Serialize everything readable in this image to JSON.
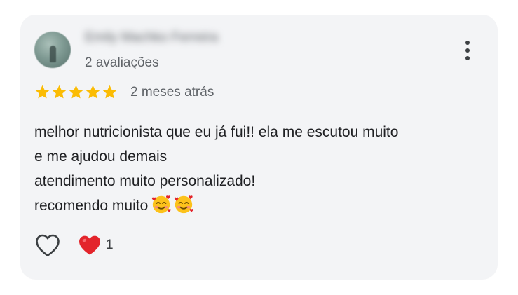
{
  "review": {
    "reviewer_name": "Emily Machko Ferreira",
    "review_count": "2 avaliações",
    "rating": 5,
    "rating_max": 5,
    "time_ago": "2 meses atrás",
    "text_lines": [
      "melhor nutricionista que eu já fui!! ela me escutou muito",
      "e me ajudou demais",
      "atendimento muito personalizado!",
      "recomendo muito"
    ],
    "emojis": [
      "🥰",
      "🥰"
    ],
    "reactions": {
      "heart_count": "1"
    }
  },
  "icons": {
    "menu": "more-vert-icon",
    "like": "heart-outline-icon",
    "reaction": "red-heart-icon",
    "star": "star-icon",
    "emoji": "smiling-face-with-hearts-icon"
  },
  "colors": {
    "card_background": "#f3f4f6",
    "star": "#fbbc04",
    "heart": "#e3242b",
    "secondary_text": "#5f6368",
    "primary_text": "#202124"
  }
}
